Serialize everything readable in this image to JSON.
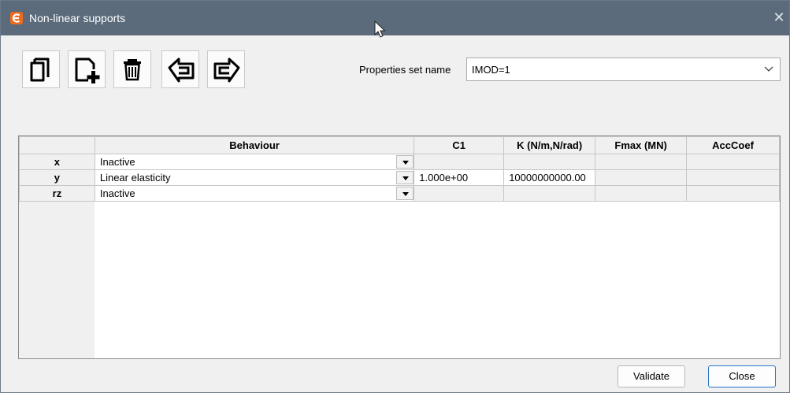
{
  "window": {
    "title": "Non-linear supports",
    "close_symbol": "✕"
  },
  "toolbar": {
    "buttons": [
      {
        "name": "copy",
        "icon": "copy-sheets-icon"
      },
      {
        "name": "new",
        "icon": "new-sheet-plus-icon"
      },
      {
        "name": "delete",
        "icon": "trash-icon"
      },
      {
        "name": "import",
        "icon": "arrow-back-icon"
      },
      {
        "name": "export",
        "icon": "arrow-forward-icon"
      }
    ]
  },
  "properties": {
    "label": "Properties set name",
    "selected": "IMOD=1"
  },
  "table": {
    "headers": [
      "",
      "Behaviour",
      "C1",
      "K (N/m,N/rad)",
      "Fmax (MN)",
      "AccCoef"
    ],
    "rows": [
      {
        "dof": "x",
        "behaviour": "Inactive",
        "c1": "",
        "k": "",
        "fmax": "",
        "acc": ""
      },
      {
        "dof": "y",
        "behaviour": "Linear elasticity",
        "c1": "1.000e+00",
        "k": "10000000000.00",
        "fmax": "",
        "acc": ""
      },
      {
        "dof": "rz",
        "behaviour": "Inactive",
        "c1": "",
        "k": "",
        "fmax": "",
        "acc": ""
      }
    ]
  },
  "buttons": {
    "validate": "Validate",
    "close": "Close"
  },
  "colors": {
    "titlebar": "#5b6b7b",
    "app_icon": "#f06a1d",
    "primary_border": "#2a73c8"
  }
}
